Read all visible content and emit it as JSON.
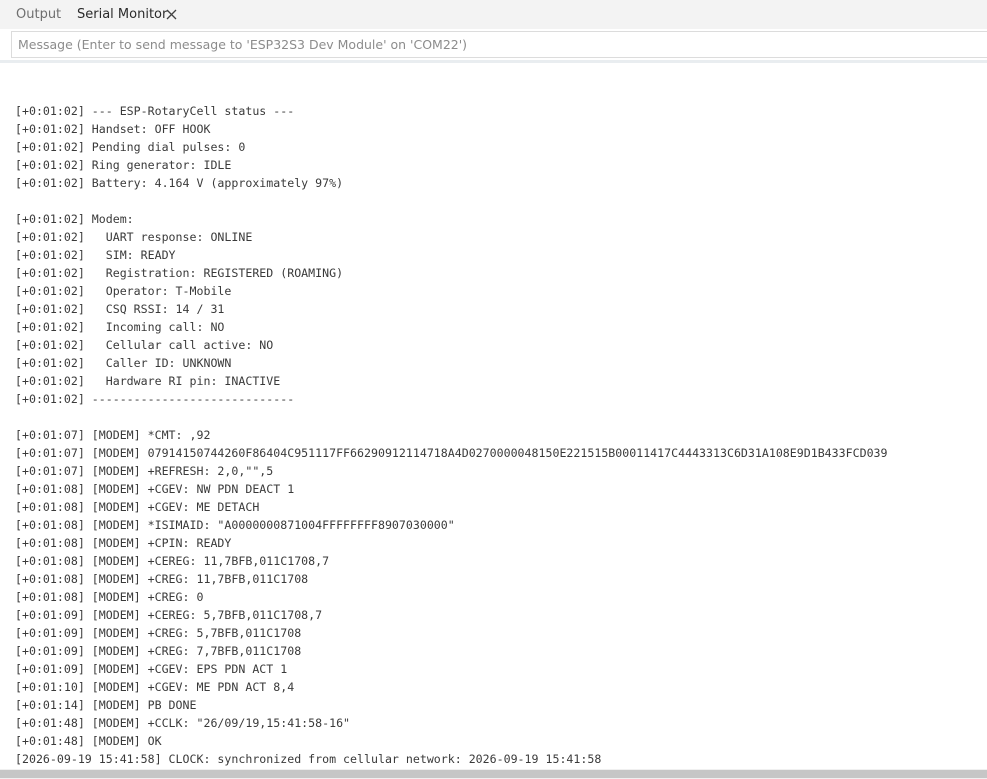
{
  "tabs": {
    "output_label": "Output",
    "serial_monitor_label": "Serial Monitor"
  },
  "message": {
    "placeholder": "Message (Enter to send message to 'ESP32S3 Dev Module' on 'COM22')",
    "value": ""
  },
  "console": {
    "lines": [
      "[+0:01:02] --- ESP-RotaryCell status ---",
      "[+0:01:02] Handset: OFF HOOK",
      "[+0:01:02] Pending dial pulses: 0",
      "[+0:01:02] Ring generator: IDLE",
      "[+0:01:02] Battery: 4.164 V (approximately 97%)",
      "",
      "[+0:01:02] Modem:",
      "[+0:01:02]   UART response: ONLINE",
      "[+0:01:02]   SIM: READY",
      "[+0:01:02]   Registration: REGISTERED (ROAMING)",
      "[+0:01:02]   Operator: T-Mobile",
      "[+0:01:02]   CSQ RSSI: 14 / 31",
      "[+0:01:02]   Incoming call: NO",
      "[+0:01:02]   Cellular call active: NO",
      "[+0:01:02]   Caller ID: UNKNOWN",
      "[+0:01:02]   Hardware RI pin: INACTIVE",
      "[+0:01:02] -----------------------------",
      "",
      "[+0:01:07] [MODEM] *CMT: ,92",
      "[+0:01:07] [MODEM] 07914150744260F86404C951117FF66290912114718A4D0270000048150E221515B00011417C4443313C6D31A108E9D1B433FCD039",
      "[+0:01:07] [MODEM] +REFRESH: 2,0,\"\",5",
      "[+0:01:08] [MODEM] +CGEV: NW PDN DEACT 1",
      "[+0:01:08] [MODEM] +CGEV: ME DETACH",
      "[+0:01:08] [MODEM] *ISIMAID: \"A0000000871004FFFFFFFF8907030000\"",
      "[+0:01:08] [MODEM] +CPIN: READY",
      "[+0:01:08] [MODEM] +CEREG: 11,7BFB,011C1708,7",
      "[+0:01:08] [MODEM] +CREG: 11,7BFB,011C1708",
      "[+0:01:08] [MODEM] +CREG: 0",
      "[+0:01:09] [MODEM] +CEREG: 5,7BFB,011C1708,7",
      "[+0:01:09] [MODEM] +CREG: 5,7BFB,011C1708",
      "[+0:01:09] [MODEM] +CREG: 7,7BFB,011C1708",
      "[+0:01:09] [MODEM] +CGEV: EPS PDN ACT 1",
      "[+0:01:10] [MODEM] +CGEV: ME PDN ACT 8,4",
      "[+0:01:14] [MODEM] PB DONE",
      "[+0:01:48] [MODEM] +CCLK: \"26/09/19,15:41:58-16\"",
      "[+0:01:48] [MODEM] OK",
      "[2026-09-19 15:41:58] CLOCK: synchronized from cellular network: 2026-09-19 15:41:58"
    ]
  }
}
